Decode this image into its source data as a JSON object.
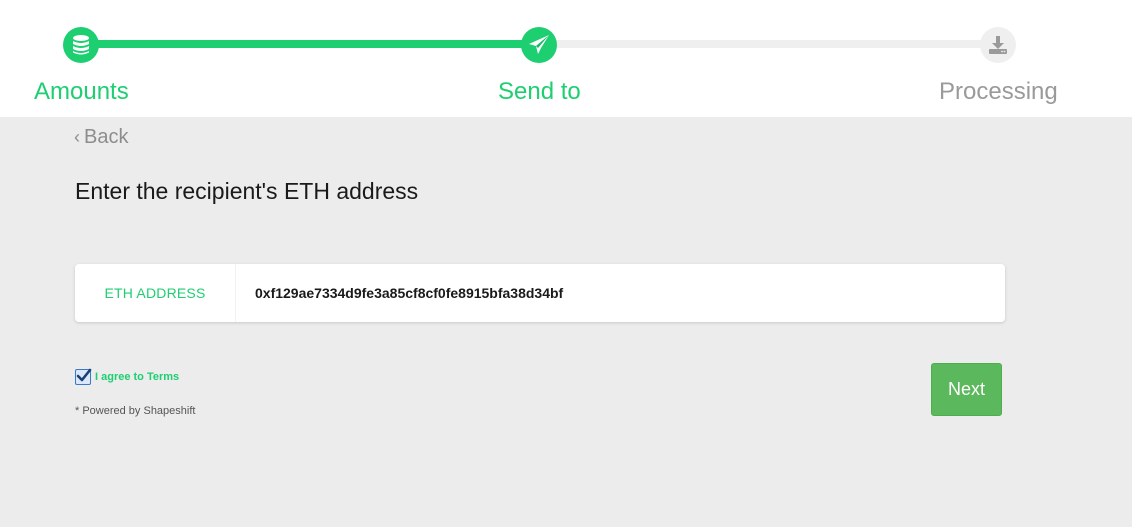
{
  "stepper": {
    "steps": [
      {
        "label": "Amounts",
        "icon": "database-icon",
        "state": "done"
      },
      {
        "label": "Send to",
        "icon": "paper-plane-icon",
        "state": "active"
      },
      {
        "label": "Processing",
        "icon": "download-icon",
        "state": "pending"
      }
    ],
    "colors": {
      "active": "#1ecf71",
      "pending": "#9a9a9a",
      "track_pending": "#efefef"
    }
  },
  "back": {
    "label": "Back",
    "icon": "chevron-left-icon"
  },
  "heading": "Enter the recipient's ETH address",
  "address_field": {
    "label": "ETH ADDRESS",
    "value": "0xf129ae7334d9fe3a85cf8cf0fe8915bfa38d34bf"
  },
  "terms": {
    "label": "I agree to Terms",
    "checked": true
  },
  "powered_by": "* Powered by Shapeshift",
  "next_button": {
    "label": "Next",
    "color": "#5cb85c"
  }
}
